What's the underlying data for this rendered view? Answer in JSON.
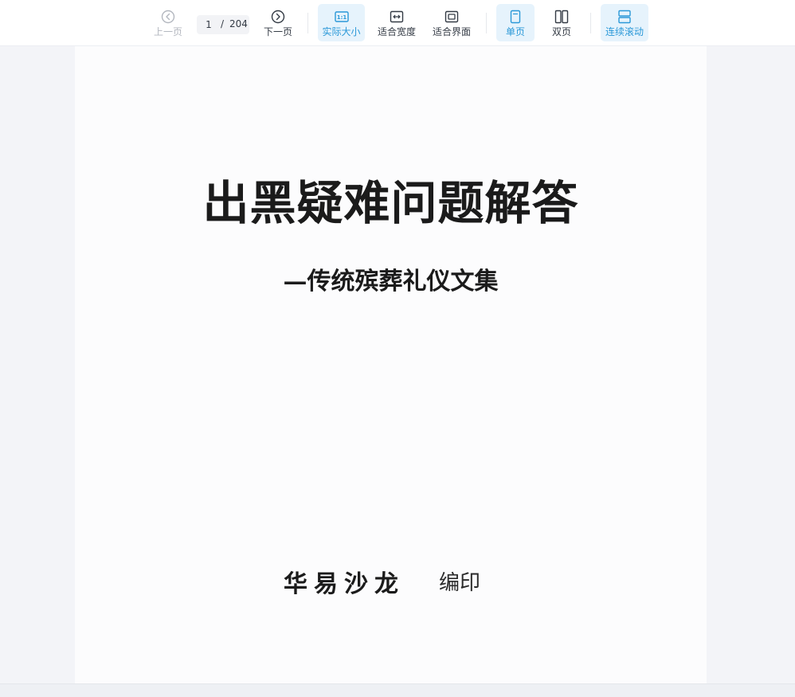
{
  "toolbar": {
    "prev_label": "上一页",
    "next_label": "下一页",
    "current_page": "1",
    "page_separator": "/",
    "total_pages": "204",
    "actual_size_label": "实际大小",
    "actual_size_icon_text": "1:1",
    "fit_width_label": "适合宽度",
    "fit_page_label": "适合界面",
    "single_page_label": "单页",
    "double_page_label": "双页",
    "continuous_scroll_label": "连续滚动",
    "accent_color": "#2a98d8",
    "active_bg": "#e6f3fc",
    "icons": {
      "prev": "chevron-left-circle-icon",
      "next": "chevron-right-circle-icon",
      "actual_size": "one-to-one-icon",
      "fit_width": "fit-width-icon",
      "fit_page": "fit-page-icon",
      "single_page": "single-page-icon",
      "double_page": "double-page-icon",
      "continuous_scroll": "continuous-scroll-icon"
    }
  },
  "document": {
    "title": "出黑疑难问题解答",
    "subtitle": "—传统殡葬礼仪文集",
    "author": "华易沙龙",
    "author_suffix": "编印"
  }
}
